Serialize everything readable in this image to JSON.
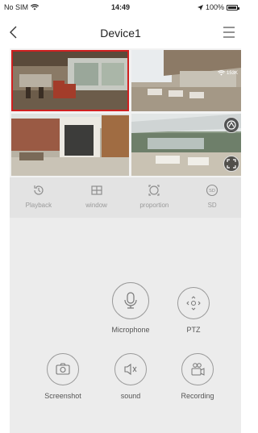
{
  "status_bar": {
    "carrier": "No SIM",
    "time": "14:49",
    "battery": "100%"
  },
  "nav": {
    "title": "Device1"
  },
  "video": {
    "bitrate": "153K"
  },
  "toolbar": {
    "items": [
      {
        "label": "Playback",
        "icon": "history-icon"
      },
      {
        "label": "window",
        "icon": "grid-icon"
      },
      {
        "label": "proportion",
        "icon": "aspect-ratio-icon"
      },
      {
        "label": "SD",
        "icon": "sd-quality-icon"
      }
    ]
  },
  "controls": {
    "microphone": "Microphone",
    "ptz": "PTZ",
    "screenshot": "Screenshot",
    "sound": "sound",
    "recording": "Recording"
  },
  "colors": {
    "selected_border": "#d02020",
    "toolbar_bg": "#e3e3e3",
    "control_bg": "#ececec"
  }
}
